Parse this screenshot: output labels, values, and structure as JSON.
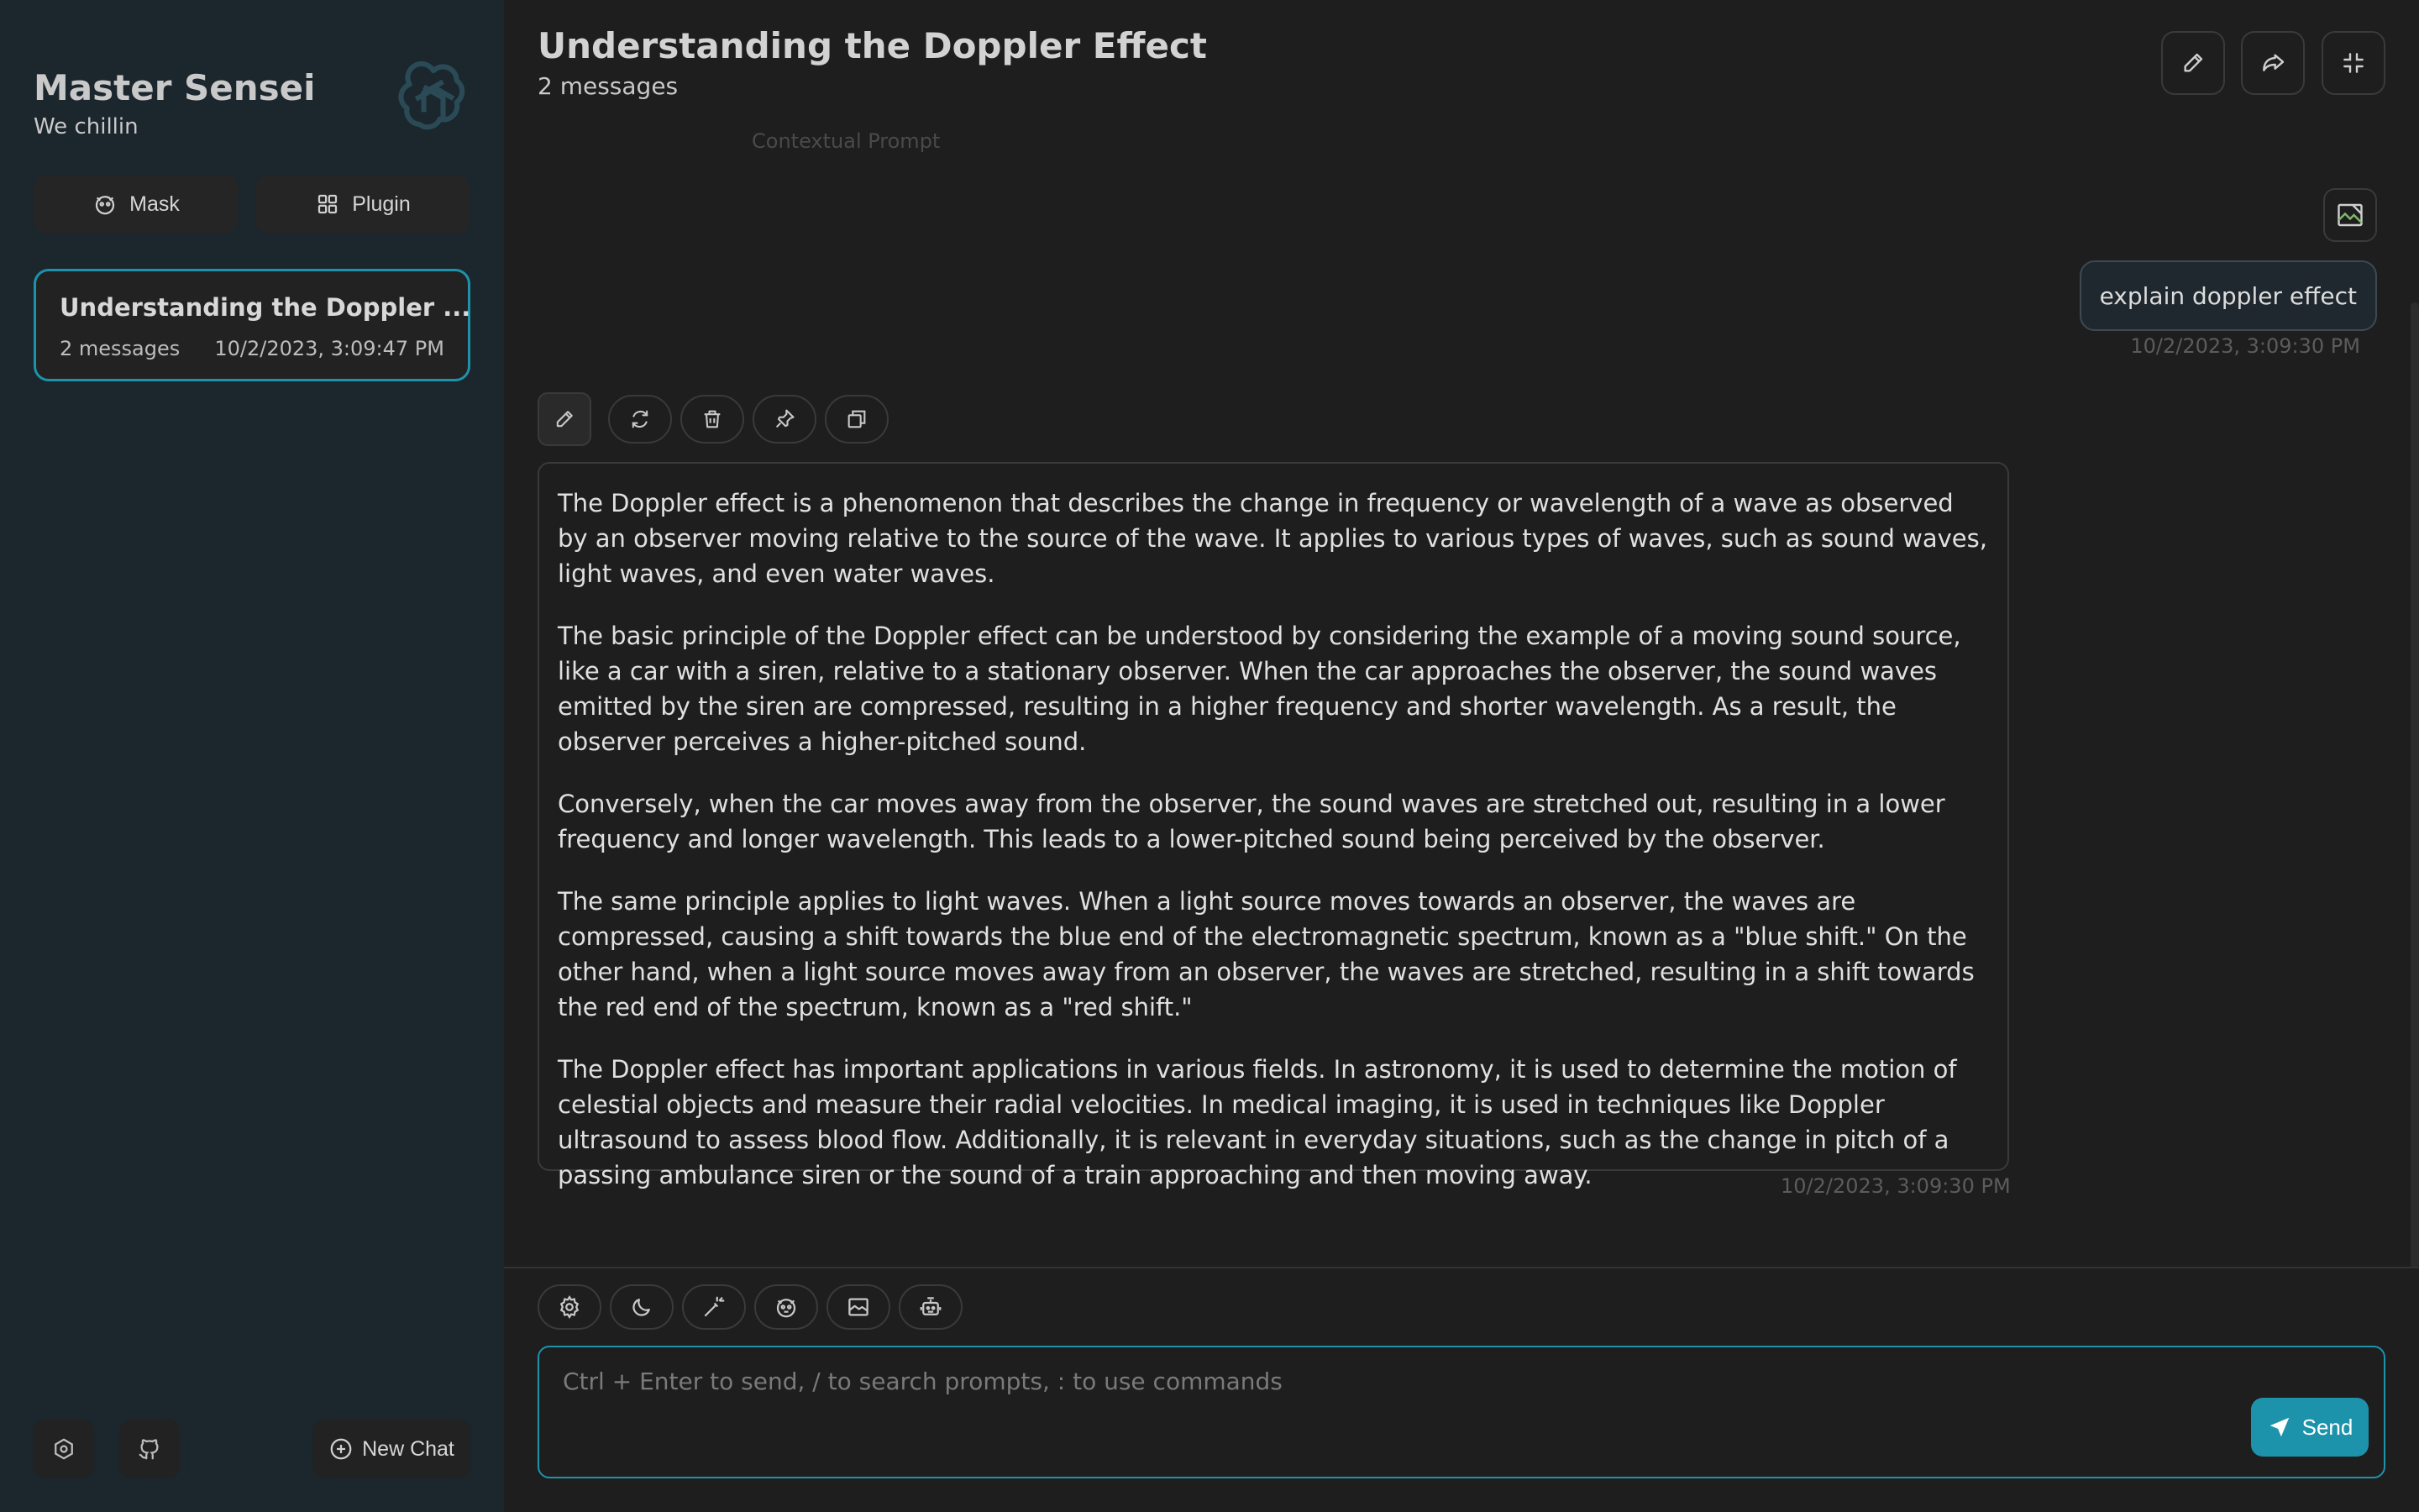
{
  "sidebar": {
    "title": "Master Sensei",
    "subtitle": "We chillin",
    "mask_label": "Mask",
    "plugin_label": "Plugin",
    "new_chat_label": "New Chat",
    "chats": [
      {
        "title": "Understanding the Doppler ...",
        "count": "2 messages",
        "date": "10/2/2023, 3:09:47 PM"
      }
    ]
  },
  "header": {
    "title": "Understanding the Doppler Effect",
    "subtitle": "2 messages",
    "context_prompt": "Contextual Prompt"
  },
  "messages": {
    "user": {
      "text": "explain doppler effect",
      "time": "10/2/2023, 3:09:30 PM"
    },
    "assistant": {
      "paragraphs": [
        "The Doppler effect is a phenomenon that describes the change in frequency or wavelength of a wave as observed by an observer moving relative to the source of the wave. It applies to various types of waves, such as sound waves, light waves, and even water waves.",
        "The basic principle of the Doppler effect can be understood by considering the example of a moving sound source, like a car with a siren, relative to a stationary observer. When the car approaches the observer, the sound waves emitted by the siren are compressed, resulting in a higher frequency and shorter wavelength. As a result, the observer perceives a higher-pitched sound.",
        "Conversely, when the car moves away from the observer, the sound waves are stretched out, resulting in a lower frequency and longer wavelength. This leads to a lower-pitched sound being perceived by the observer.",
        "The same principle applies to light waves. When a light source moves towards an observer, the waves are compressed, causing a shift towards the blue end of the electromagnetic spectrum, known as a \"blue shift.\" On the other hand, when a light source moves away from an observer, the waves are stretched, resulting in a shift towards the red end of the spectrum, known as a \"red shift.\"",
        "The Doppler effect has important applications in various fields. In astronomy, it is used to determine the motion of celestial objects and measure their radial velocities. In medical imaging, it is used in techniques like Doppler ultrasound to assess blood flow. Additionally, it is relevant in everyday situations, such as the change in pitch of a passing ambulance siren or the sound of a train approaching and then moving away."
      ],
      "time": "10/2/2023, 3:09:30 PM"
    }
  },
  "input": {
    "placeholder": "Ctrl + Enter to send, / to search prompts, : to use commands",
    "value": "",
    "send_label": "Send"
  },
  "colors": {
    "accent": "#1d93ab",
    "sidebar_bg": "#1b262d",
    "main_bg": "#1e1e1e"
  },
  "icons": {
    "header": [
      "edit-icon",
      "share-icon",
      "minimize-icon"
    ],
    "message_actions": [
      "edit-icon",
      "refresh-icon",
      "delete-icon",
      "pin-icon",
      "copy-icon"
    ],
    "toolbar": [
      "settings-icon",
      "dark-mode-icon",
      "prompt-wand-icon",
      "mask-icon",
      "image-icon",
      "robot-icon"
    ],
    "sidebar_footer": [
      "settings-icon",
      "github-icon"
    ]
  }
}
